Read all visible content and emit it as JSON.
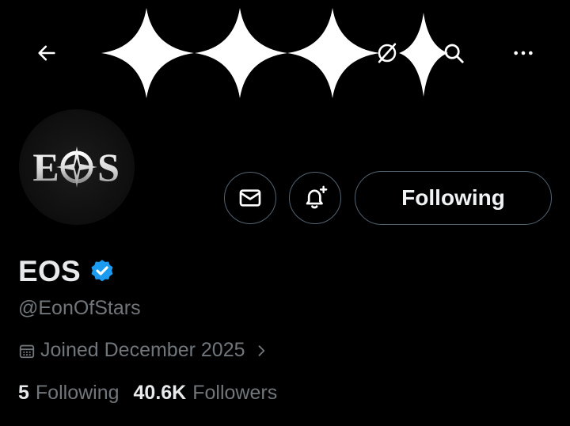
{
  "header": {
    "back_icon": "arrow-left-icon",
    "grok_icon": "grok-icon",
    "search_icon": "search-icon",
    "more_icon": "more-horizontal-icon"
  },
  "avatar": {
    "logo_text": "EOS"
  },
  "actions": {
    "message_icon": "envelope-icon",
    "notify_icon": "bell-plus-icon",
    "follow_label": "Following"
  },
  "profile": {
    "display_name": "EOS",
    "verified": true,
    "handle": "@EonOfStars",
    "joined": "Joined December 2025",
    "following_count": "5",
    "following_label": "Following",
    "followers_count": "40.6K",
    "followers_label": "Followers"
  },
  "colors": {
    "background": "#000000",
    "text_primary": "#e7e9ea",
    "text_secondary": "#71767b",
    "border": "#536471",
    "verified_blue": "#1d9bf0"
  }
}
